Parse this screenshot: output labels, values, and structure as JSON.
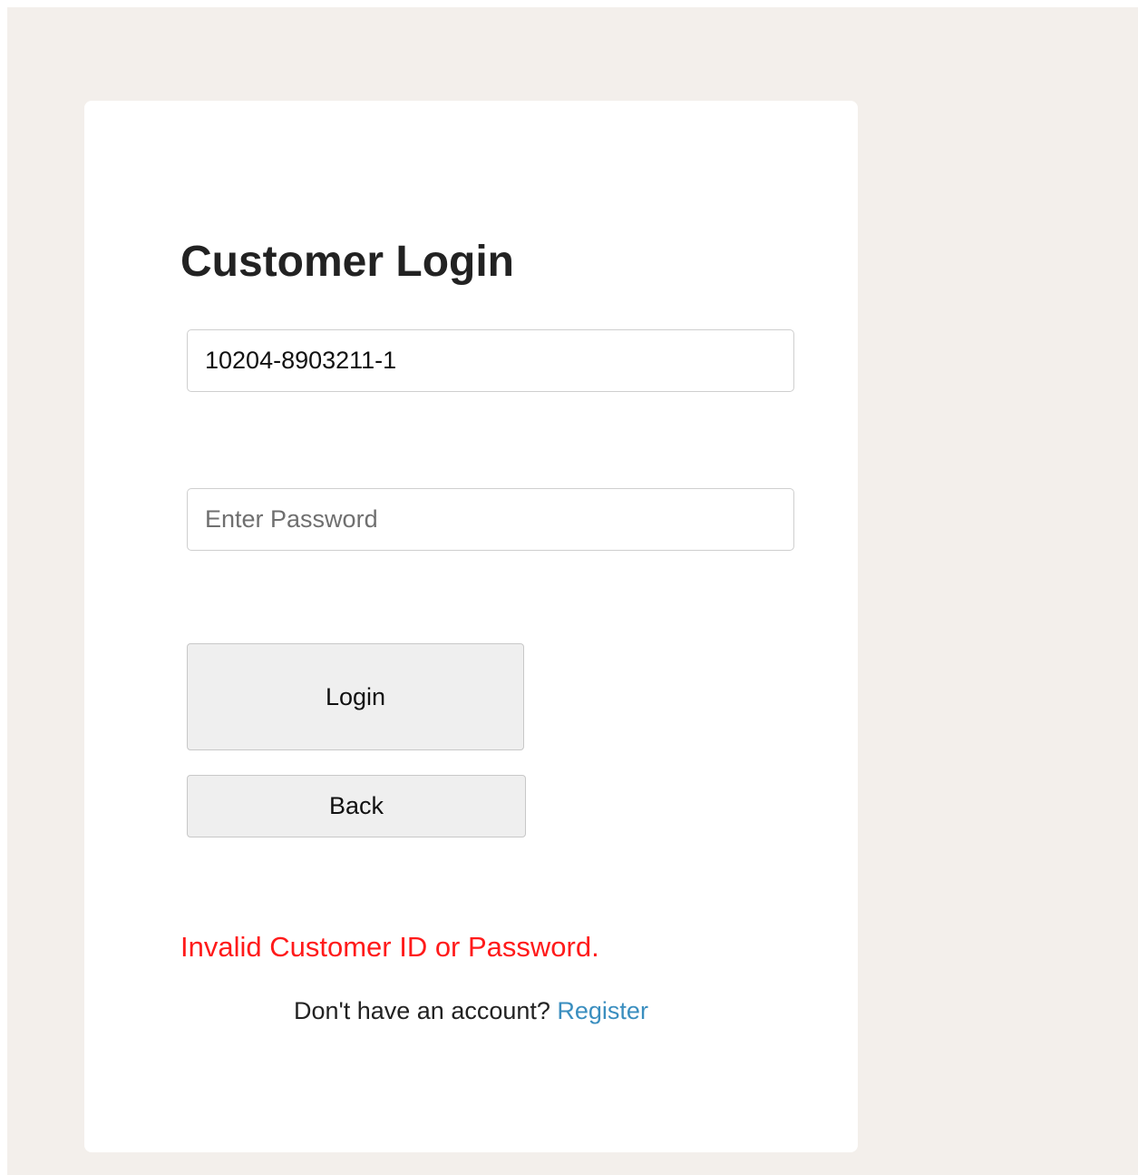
{
  "login": {
    "title": "Customer Login",
    "customer_id_value": "10204-8903211-1",
    "password_placeholder": "Enter Password",
    "login_button": "Login",
    "back_button": "Back",
    "error_message": "Invalid Customer ID or Password.",
    "register_prompt": "Don't have an account?",
    "register_link": "Register"
  },
  "colors": {
    "page_background": "#f3efeb",
    "card_background": "#ffffff",
    "error": "#ff1a1a",
    "link": "#3a8ebf",
    "button_background": "#efefef"
  }
}
